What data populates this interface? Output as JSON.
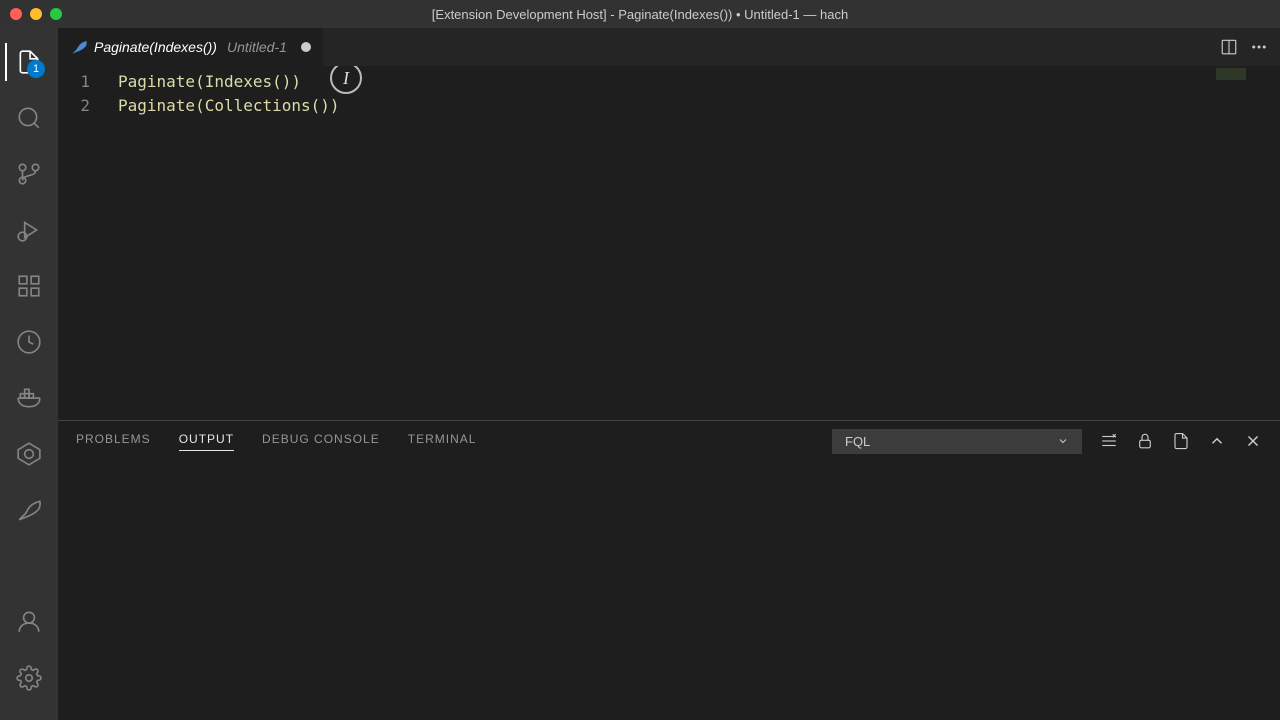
{
  "titlebar": {
    "text": "[Extension Development Host] - Paginate(Indexes()) • Untitled-1 — hach"
  },
  "activitybar": {
    "explorer_badge": "1"
  },
  "tab": {
    "filename": "Paginate(Indexes())",
    "secondary": "Untitled-1"
  },
  "editor": {
    "lines": {
      "num1": "1",
      "num2": "2",
      "line1": "Paginate(Indexes())",
      "line2": "Paginate(Collections())"
    }
  },
  "panel": {
    "tabs": {
      "problems": "PROBLEMS",
      "output": "OUTPUT",
      "debug": "DEBUG CONSOLE",
      "terminal": "TERMINAL"
    },
    "select_value": "FQL"
  }
}
